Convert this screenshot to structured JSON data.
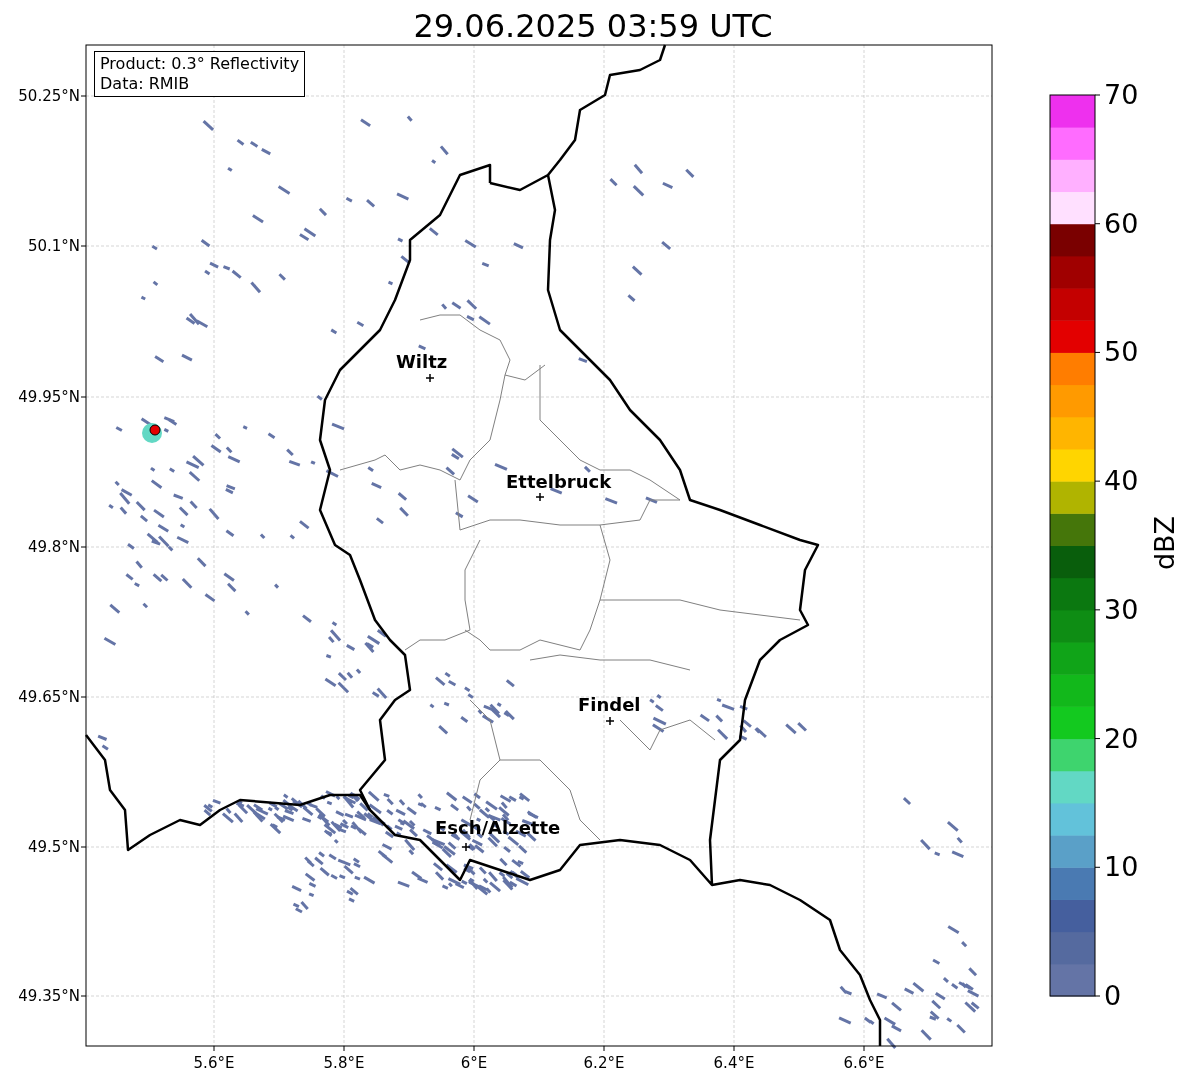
{
  "title": "29.06.2025 03:59 UTC",
  "info_box": [
    "Product: 0.3° Reflectivity",
    "Data: RMIB"
  ],
  "lat_ticks": [
    "50.25°N",
    "50.1°N",
    "49.95°N",
    "49.8°N",
    "49.65°N",
    "49.5°N",
    "49.35°N"
  ],
  "lon_ticks": [
    "5.6°E",
    "5.8°E",
    "6°E",
    "6.2°E",
    "6.4°E",
    "6.6°E"
  ],
  "cities": [
    {
      "name": "Wiltz"
    },
    {
      "name": "Ettelbruck"
    },
    {
      "name": "Findel"
    },
    {
      "name": "Esch/Alzette"
    }
  ],
  "colorbar": {
    "label": "dBZ",
    "ticks": [
      "70",
      "60",
      "50",
      "40",
      "30",
      "20",
      "10",
      "0"
    ],
    "bands": [
      {
        "color": "#6474a6"
      },
      {
        "color": "#556a9f"
      },
      {
        "color": "#455f9e"
      },
      {
        "color": "#4a7ab2"
      },
      {
        "color": "#5aa0c8"
      },
      {
        "color": "#62c2da"
      },
      {
        "color": "#62d8c4"
      },
      {
        "color": "#3ed46e"
      },
      {
        "color": "#13c91f"
      },
      {
        "color": "#12b81b"
      },
      {
        "color": "#10a418"
      },
      {
        "color": "#0e8d14"
      },
      {
        "color": "#0b7810"
      },
      {
        "color": "#095e0c"
      },
      {
        "color": "#45760a"
      },
      {
        "color": "#b0b400"
      },
      {
        "color": "#ffd500"
      },
      {
        "color": "#ffb500"
      },
      {
        "color": "#ff9a00"
      },
      {
        "color": "#ff7d00"
      },
      {
        "color": "#e30000"
      },
      {
        "color": "#c40000"
      },
      {
        "color": "#a00000"
      },
      {
        "color": "#7a0000"
      },
      {
        "color": "#ffe0ff"
      },
      {
        "color": "#ffb0ff"
      },
      {
        "color": "#ff6cff"
      },
      {
        "color": "#ee30ee"
      }
    ]
  }
}
